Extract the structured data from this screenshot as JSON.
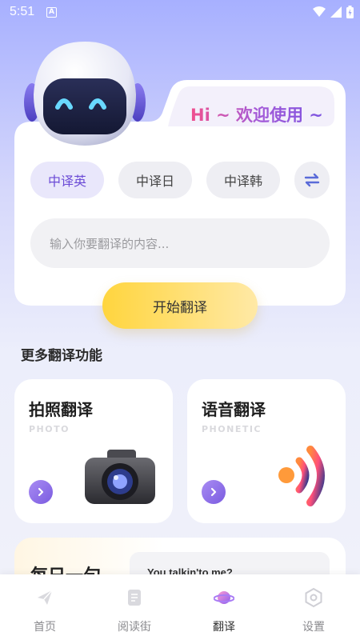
{
  "status_bar": {
    "time": "5:51",
    "notif_glyph": "A"
  },
  "greeting": "Hi ~ 欢迎使用 ~",
  "lang_options": [
    {
      "label": "中译英",
      "active": true
    },
    {
      "label": "中译日",
      "active": false
    },
    {
      "label": "中译韩",
      "active": false
    }
  ],
  "swap_icon": "swap-arrows-icon",
  "input": {
    "placeholder": "输入你要翻译的内容...",
    "value": ""
  },
  "start_button": "开始翻译",
  "more_section": {
    "title": "更多翻译功能"
  },
  "features": [
    {
      "title": "拍照翻译",
      "subtitle": "PHOTO",
      "icon": "camera-icon"
    },
    {
      "title": "语音翻译",
      "subtitle": "PHONETIC",
      "icon": "sound-wave-icon"
    }
  ],
  "daily": {
    "title": "每日一句",
    "quote": "You talkin'to me?"
  },
  "tabs": [
    {
      "label": "首页",
      "icon": "paper-plane-icon",
      "active": false
    },
    {
      "label": "阅读街",
      "icon": "document-icon",
      "active": false
    },
    {
      "label": "翻译",
      "icon": "planet-icon",
      "active": true
    },
    {
      "label": "设置",
      "icon": "settings-icon",
      "active": false
    }
  ],
  "colors": {
    "accent": "#6b4bd6",
    "button_yellow": "#ffd53e",
    "background_top": "#a7b0ff"
  }
}
